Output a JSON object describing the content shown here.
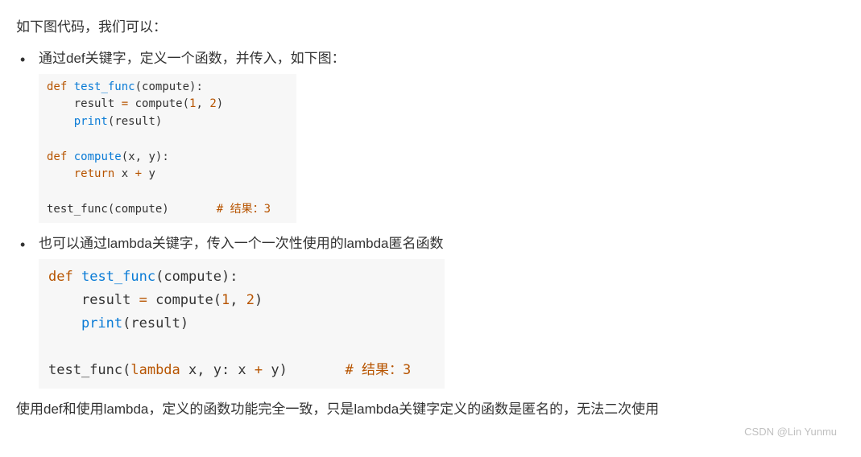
{
  "intro": "如下图代码，我们可以：",
  "bullets": [
    {
      "text": "通过def关键字，定义一个函数，并传入，如下图："
    },
    {
      "text": "也可以通过lambda关键字，传入一个一次性使用的lambda匿名函数"
    }
  ],
  "code1": {
    "kw_def1": "def",
    "fn1": "test_func",
    "p1_open": "(",
    "param1": "compute",
    "p1_close": "):",
    "line2_indent": "    ",
    "line2_a": "result ",
    "op_eq": "=",
    "line2_b": " compute(",
    "num1": "1",
    "comma": ", ",
    "num2": "2",
    "p2_close": ")",
    "line3_indent": "    ",
    "fn_print": "print",
    "p3_open": "(",
    "line3_arg": "result",
    "p3_close": ")",
    "kw_def2": "def",
    "fn2": "compute",
    "p4_open": "(",
    "param2": "x, y",
    "p4_close": "):",
    "line6_indent": "    ",
    "kw_return": "return",
    "line6_expr": " x ",
    "op_plus": "+",
    "line6_expr2": " y",
    "call": "test_func(compute)",
    "gap1": "       ",
    "comment1": "# 结果：3"
  },
  "code2": {
    "kw_def": "def",
    "fn1": "test_func",
    "p1_open": "(",
    "param1": "compute",
    "p1_close": "):",
    "line2_indent": "    ",
    "line2_a": "result ",
    "op_eq": "=",
    "line2_b": " compute(",
    "num1": "1",
    "comma": ", ",
    "num2": "2",
    "p2_close": ")",
    "line3_indent": "    ",
    "fn_print": "print",
    "p3_open": "(",
    "line3_arg": "result",
    "p3_close": ")",
    "call_a": "test_func(",
    "kw_lambda": "lambda",
    "call_b": " x, y: x ",
    "op_plus": "+",
    "call_c": " y)",
    "gap1": "       ",
    "comment1": "# 结果：3"
  },
  "conclusion": "使用def和使用lambda，定义的函数功能完全一致，只是lambda关键字定义的函数是匿名的，无法二次使用",
  "watermark": "CSDN @Lin Yunmu"
}
